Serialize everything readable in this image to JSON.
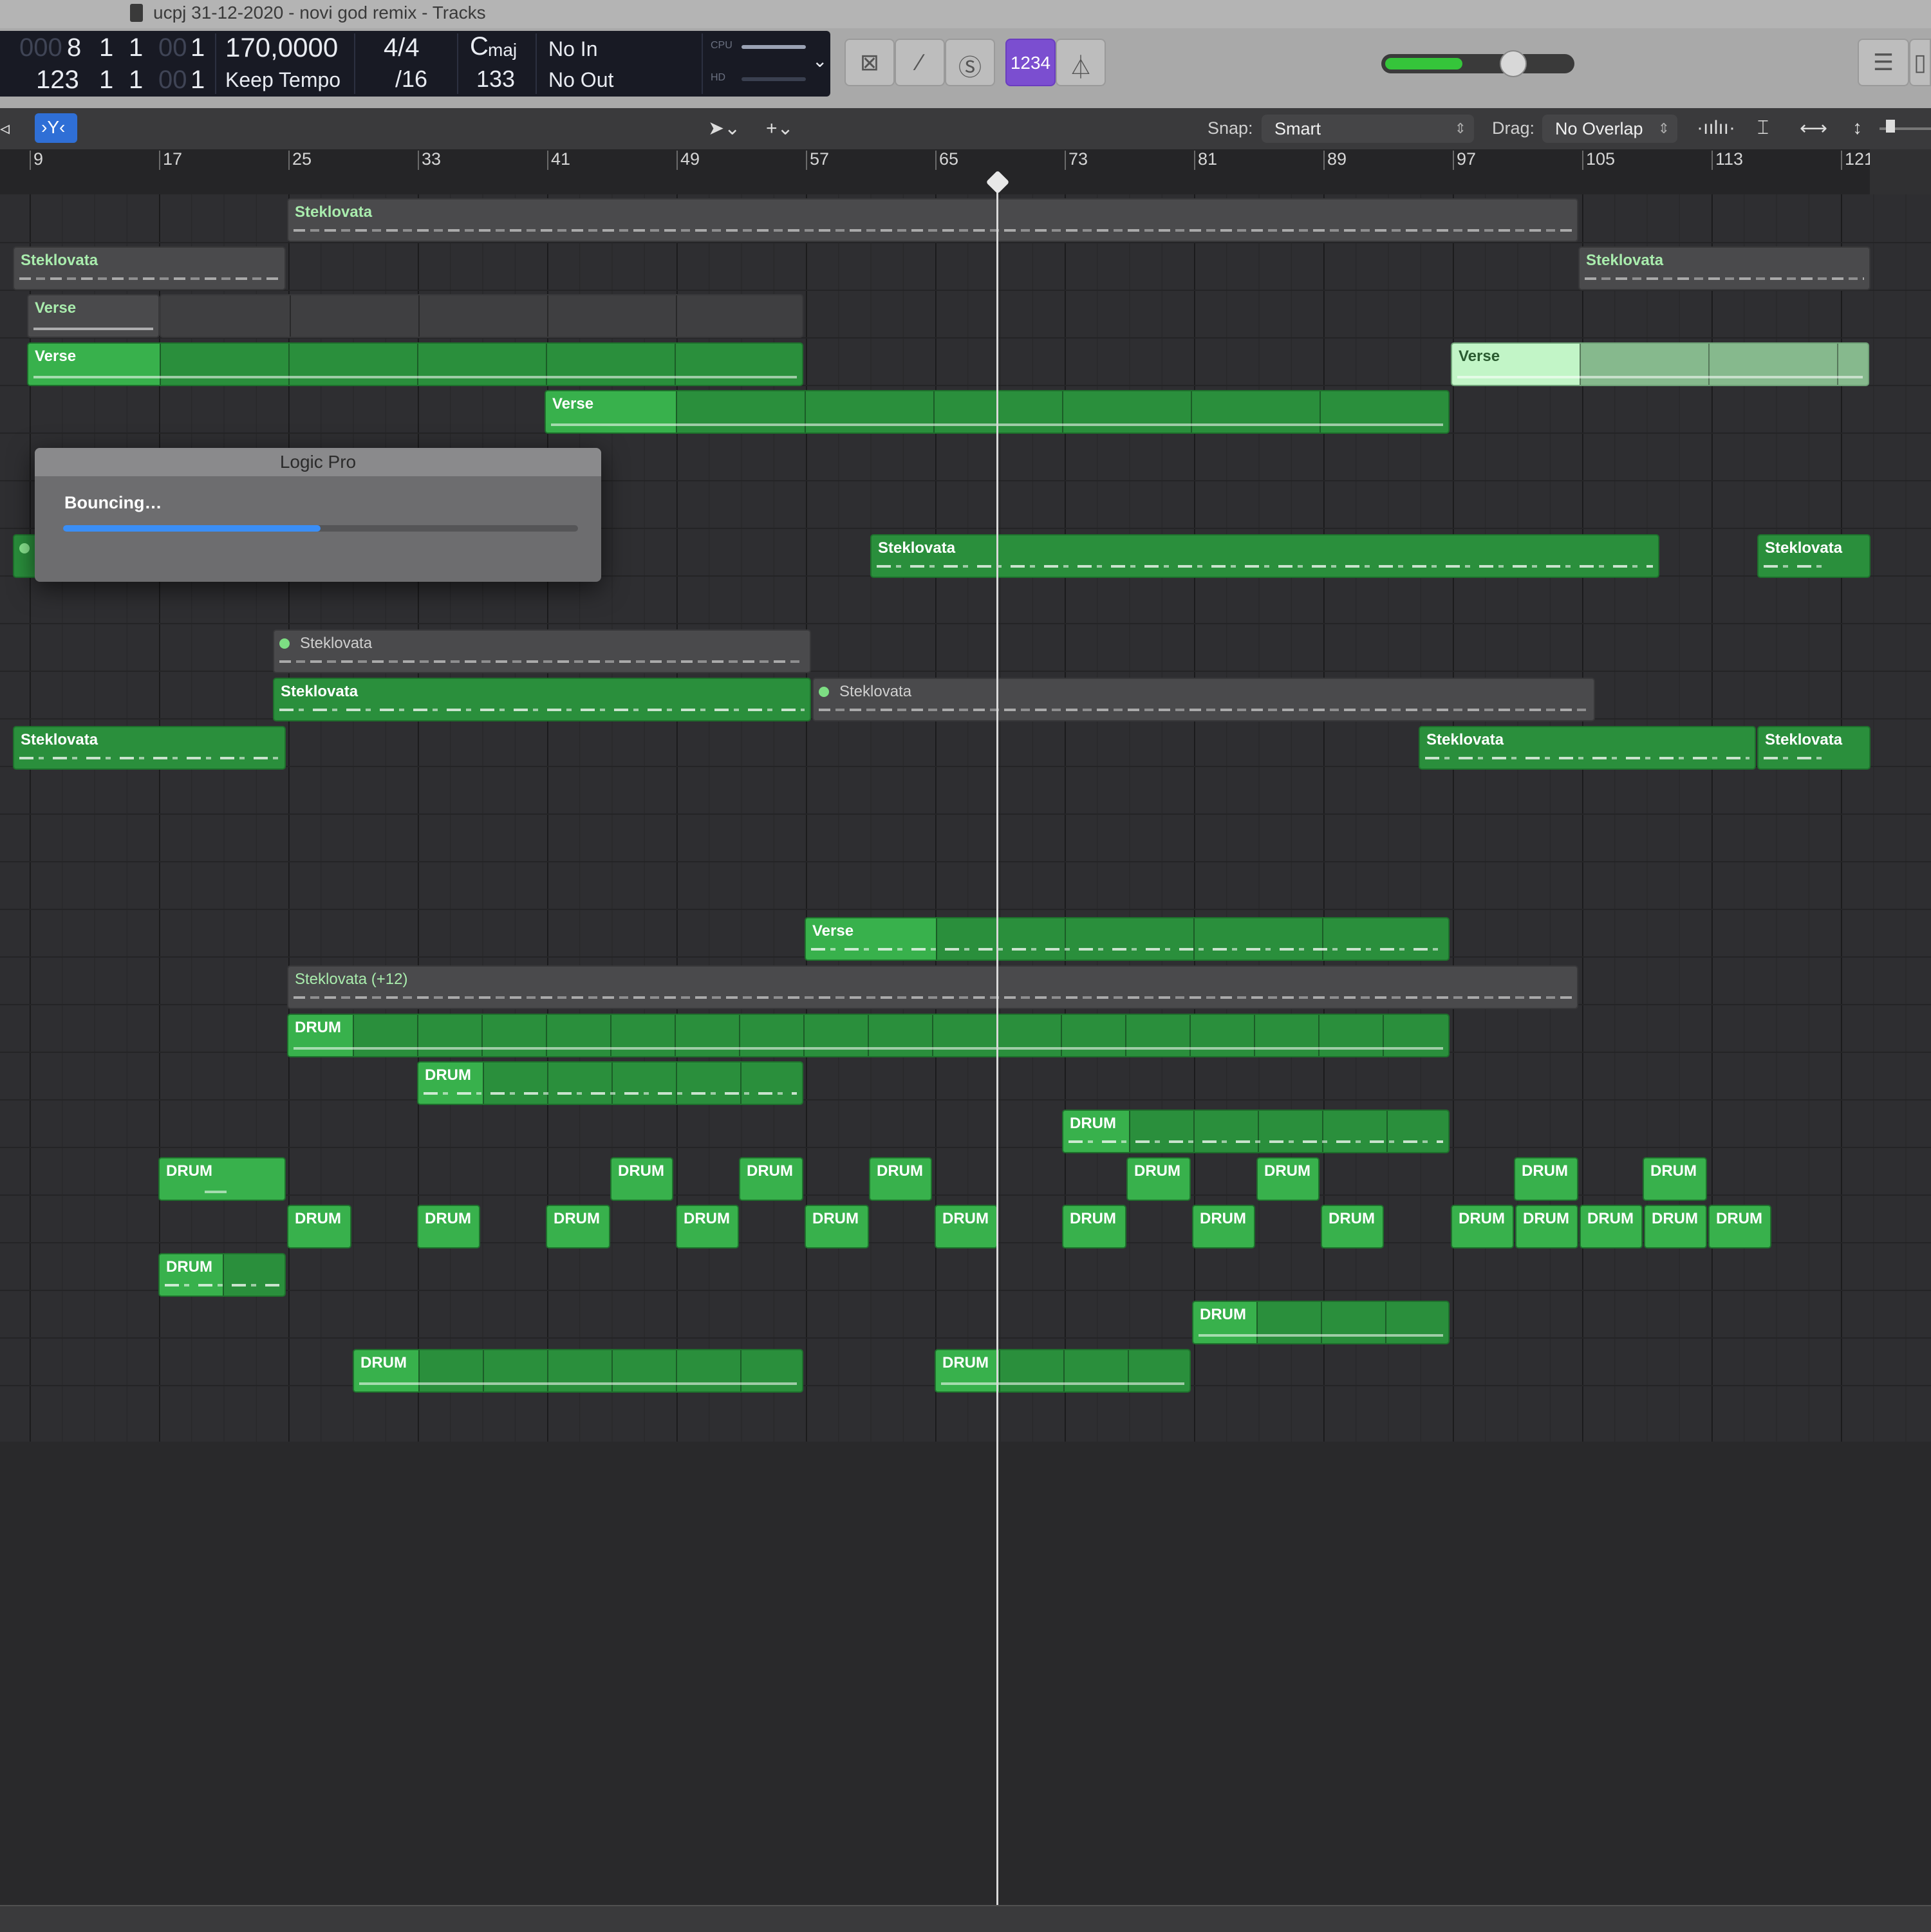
{
  "window": {
    "title": "ucpj 31-12-2020 - novi god remix - Tracks"
  },
  "lcd": {
    "position_bars_dim": "000",
    "position_bars": "8",
    "position_beat": "1",
    "position_div": "1",
    "position_tick_dim": "00",
    "position_tick": "1",
    "end_bars": "123",
    "end_beat": "1",
    "end_div": "1",
    "end_tick_dim": "00",
    "end_tick": "1",
    "tempo": "170,0000",
    "tempo_mode": "Keep Tempo",
    "signature": "4/4",
    "division": "/16",
    "key": "C",
    "key_mode": "maj",
    "key_value": "133",
    "midi_in": "No In",
    "midi_out": "No Out",
    "cpu_label": "CPU",
    "hd_label": "HD"
  },
  "controls": {
    "count_in": "1234",
    "volume_level": 0.55
  },
  "toolbar": {
    "snap_label": "Snap:",
    "snap_value": "Smart",
    "drag_label": "Drag:",
    "drag_value": "No Overlap"
  },
  "ruler": {
    "bars": [
      "9",
      "17",
      "25",
      "33",
      "41",
      "49",
      "57",
      "65",
      "73",
      "81",
      "89",
      "97",
      "105",
      "113",
      "121"
    ]
  },
  "dialog": {
    "title": "Logic Pro",
    "message": "Bouncing…",
    "progress": 0.5
  },
  "colors": {
    "region_green": "#2a8f3c",
    "region_head": "#38b14c",
    "region_grey": "#4a4a4c",
    "playhead": "#d9d9d9",
    "progress_blue": "#3a8ef6",
    "count_in_purple": "#7b4ed0"
  },
  "regions": {
    "steklovata": "Steklovata",
    "verse": "Verse",
    "drum": "DRUM",
    "steklovata_transposed": "Steklovata (+12)"
  }
}
